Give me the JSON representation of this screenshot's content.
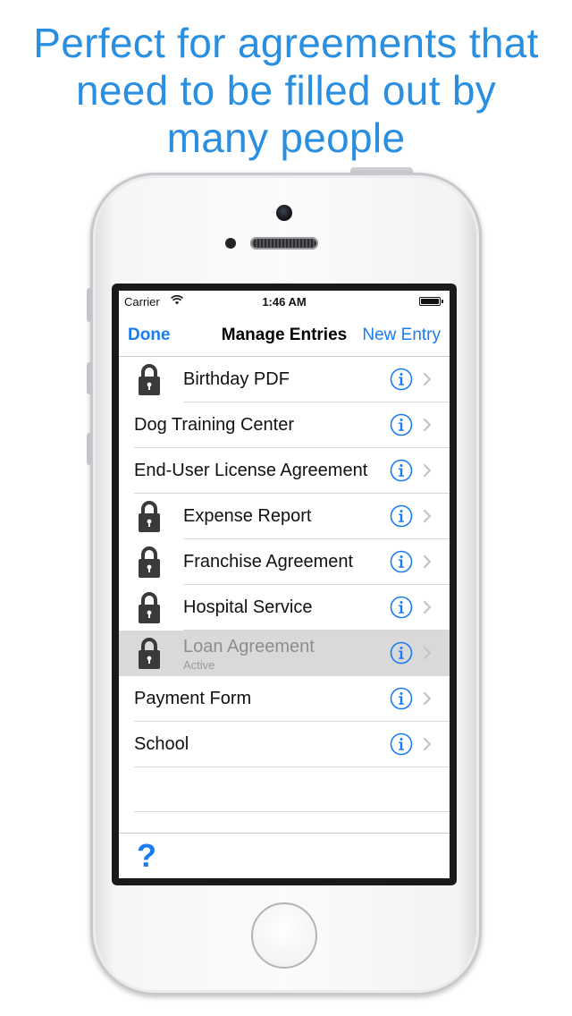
{
  "headline": {
    "line1": "Perfect for agreements that",
    "line2": "need to be filled out by",
    "line3": "many people"
  },
  "statusbar": {
    "carrier": "Carrier",
    "time": "1:46 AM"
  },
  "navbar": {
    "done_label": "Done",
    "title": "Manage Entries",
    "new_entry_label": "New Entry"
  },
  "entries": [
    {
      "label": "Birthday PDF",
      "locked": true
    },
    {
      "label": "Dog Training Center",
      "locked": false
    },
    {
      "label": "End-User License Agreement",
      "locked": false
    },
    {
      "label": "Expense Report",
      "locked": true
    },
    {
      "label": "Franchise Agreement",
      "locked": true
    },
    {
      "label": "Hospital Service",
      "locked": true
    },
    {
      "label": "Loan Agreement",
      "locked": true,
      "subtitle": "Active",
      "selected": true
    },
    {
      "label": "Payment Form",
      "locked": false
    },
    {
      "label": "School",
      "locked": false
    }
  ],
  "toolbar": {
    "help_label": "?"
  },
  "colors": {
    "accent": "#1a7cf5",
    "headline": "#2a8fe0",
    "selected_row": "#d9d9d9"
  },
  "icons": [
    "wifi-icon",
    "battery-icon",
    "lock-icon",
    "info-icon",
    "chevron-right-icon",
    "help-icon"
  ]
}
